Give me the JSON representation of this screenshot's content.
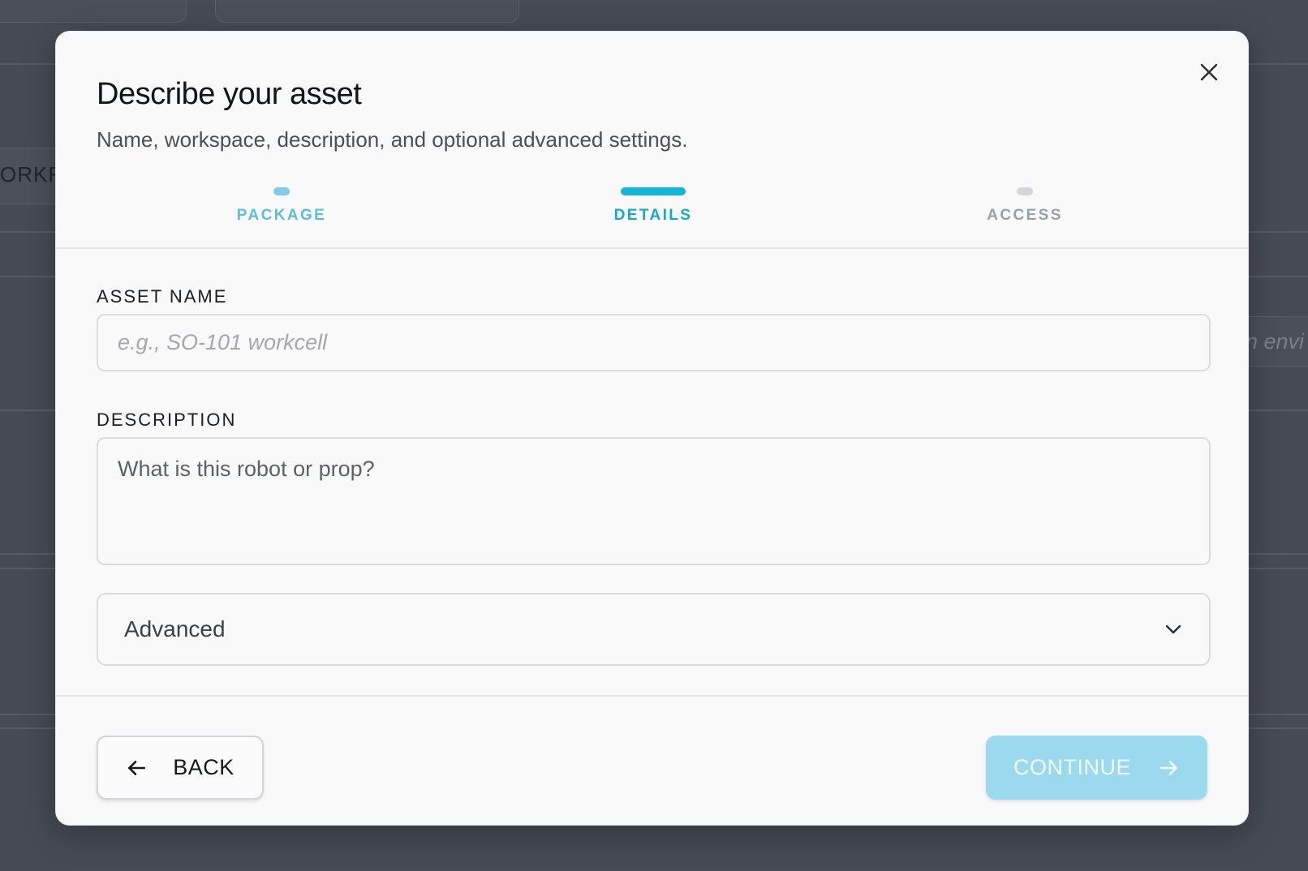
{
  "background": {
    "tab_label": "ORKF",
    "input_text": "n envi"
  },
  "modal": {
    "title": "Describe your asset",
    "subtitle": "Name, workspace, description, and optional advanced settings.",
    "close_icon": "close-icon"
  },
  "steps": [
    {
      "label": "PACKAGE",
      "state": "done"
    },
    {
      "label": "DETAILS",
      "state": "active"
    },
    {
      "label": "ACCESS",
      "state": "todo"
    }
  ],
  "fields": {
    "asset_name": {
      "label": "ASSET NAME",
      "value": "",
      "placeholder": "e.g., SO-101 workcell"
    },
    "description": {
      "label": "DESCRIPTION",
      "value": "",
      "placeholder": "What is this robot or prop?"
    },
    "advanced": {
      "label": "Advanced",
      "icon": "chevron-down-icon"
    }
  },
  "footer": {
    "back_label": "BACK",
    "back_icon": "arrow-left-icon",
    "continue_label": "CONTINUE",
    "continue_icon": "arrow-right-icon",
    "continue_enabled": false
  },
  "colors": {
    "accent": "#13b5d8",
    "accent_disabled": "#9bd9ee",
    "overlay": "#454a53"
  }
}
